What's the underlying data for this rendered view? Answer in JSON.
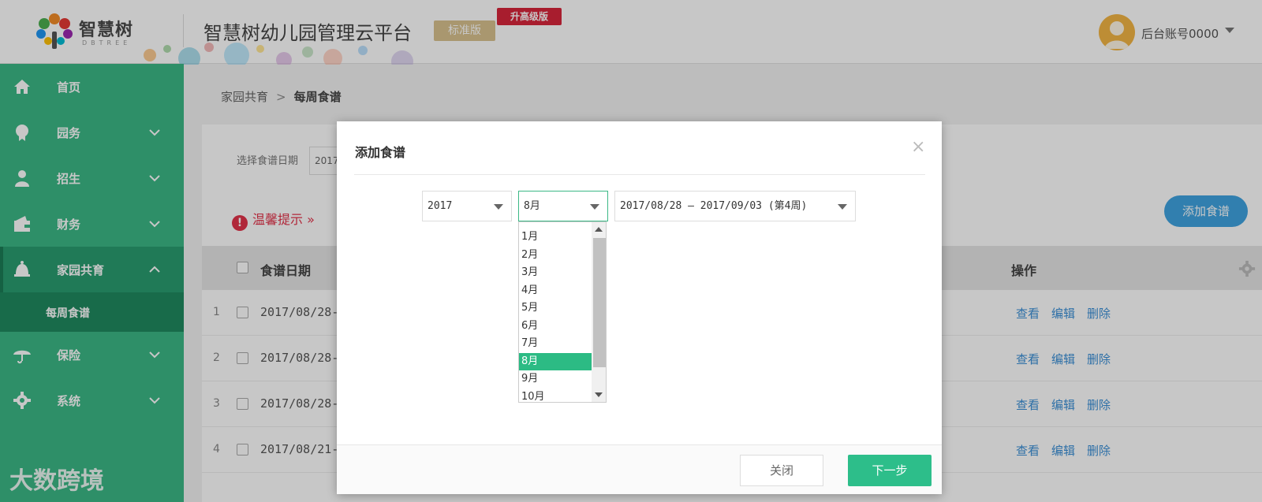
{
  "header": {
    "logo_text": "智慧树",
    "logo_sub": "DBTREE",
    "app_title": "智慧树幼儿园管理云平台",
    "edition": "标准版",
    "upgrade": "升高级版",
    "account": "后台账号0000"
  },
  "sidebar": {
    "items": [
      {
        "label": "首页",
        "icon": "home-icon"
      },
      {
        "label": "园务",
        "icon": "badge-icon"
      },
      {
        "label": "招生",
        "icon": "user-icon"
      },
      {
        "label": "财务",
        "icon": "wallet-icon"
      },
      {
        "label": "家园共育",
        "icon": "bell-icon"
      },
      {
        "label": "保险",
        "icon": "umbrella-icon"
      },
      {
        "label": "系统",
        "icon": "gear-icon"
      }
    ],
    "sub_item": "每周食谱",
    "watermark": "大数跨境"
  },
  "breadcrumb": {
    "parent": "家园共育",
    "separator": ">",
    "current": "每周食谱"
  },
  "filter": {
    "label": "选择食谱日期",
    "value": "2017"
  },
  "tip": "温馨提示",
  "add_button": "添加食谱",
  "table": {
    "col_date": "食谱日期",
    "col_action": "操作",
    "rows": [
      {
        "num": "1",
        "date": "2017/08/28-"
      },
      {
        "num": "2",
        "date": "2017/08/28-"
      },
      {
        "num": "3",
        "date": "2017/08/28-"
      },
      {
        "num": "4",
        "date": "2017/08/21-"
      }
    ],
    "actions": {
      "view": "查看",
      "edit": "编辑",
      "delete": "删除"
    }
  },
  "modal": {
    "title": "添加食谱",
    "close_glyph": "×",
    "year": "2017",
    "month": "8月",
    "week": "2017/08/28 — 2017/09/03 (第4周)",
    "month_options": [
      "1月",
      "2月",
      "3月",
      "4月",
      "5月",
      "6月",
      "7月",
      "8月",
      "9月",
      "10月"
    ],
    "selected_month_index": 7,
    "btn_close": "关闭",
    "btn_next": "下一步"
  },
  "colors": {
    "sidebar": "#3cb886",
    "accent": "#2dbe8a",
    "link": "#3a8fd6",
    "warning": "#e2324a"
  }
}
